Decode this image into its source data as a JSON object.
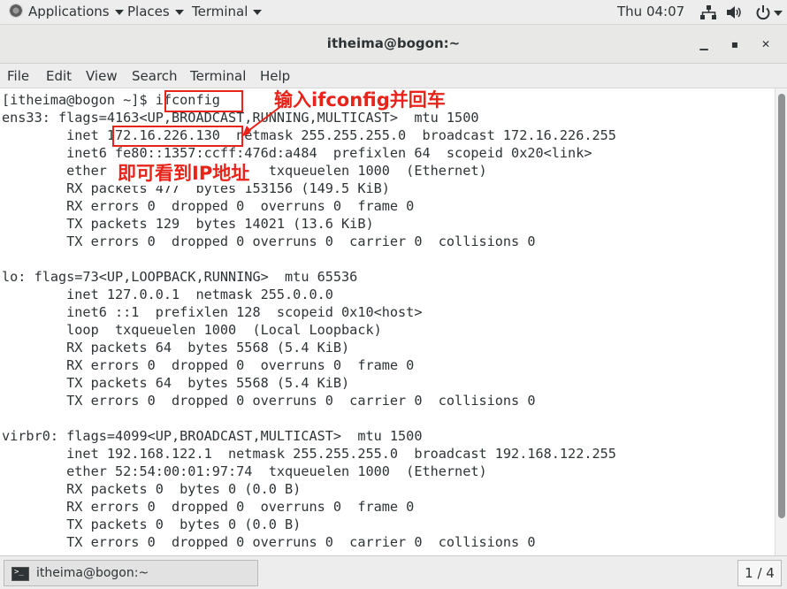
{
  "top_panel": {
    "applications_label": "Applications",
    "places_label": "Places",
    "terminal_label": "Terminal",
    "clock": "Thu 04:07"
  },
  "window": {
    "title": "itheima@bogon:~",
    "minimize_glyph": "▁",
    "maximize_glyph": "▪",
    "close_glyph": "✕"
  },
  "menubar": {
    "file": "File",
    "edit": "Edit",
    "view": "View",
    "search": "Search",
    "terminal": "Terminal",
    "help": "Help"
  },
  "terminal": {
    "lines": [
      "[itheima@bogon ~]$ ifconfig",
      "ens33: flags=4163<UP,BROADCAST,RUNNING,MULTICAST>  mtu 1500",
      "        inet 172.16.226.130  netmask 255.255.255.0  broadcast 172.16.226.255",
      "        inet6 fe80::1357:ccff:476d:a484  prefixlen 64  scopeid 0x20<link>",
      "        ether 00:0c:29:1a:2b:3c  txqueuelen 1000  (Ethernet)",
      "        RX packets 477  bytes 153156 (149.5 KiB)",
      "        RX errors 0  dropped 0  overruns 0  frame 0",
      "        TX packets 129  bytes 14021 (13.6 KiB)",
      "        TX errors 0  dropped 0 overruns 0  carrier 0  collisions 0",
      "",
      "lo: flags=73<UP,LOOPBACK,RUNNING>  mtu 65536",
      "        inet 127.0.0.1  netmask 255.0.0.0",
      "        inet6 ::1  prefixlen 128  scopeid 0x10<host>",
      "        loop  txqueuelen 1000  (Local Loopback)",
      "        RX packets 64  bytes 5568 (5.4 KiB)",
      "        RX errors 0  dropped 0  overruns 0  frame 0",
      "        TX packets 64  bytes 5568 (5.4 KiB)",
      "        TX errors 0  dropped 0 overruns 0  carrier 0  collisions 0",
      "",
      "virbr0: flags=4099<UP,BROADCAST,MULTICAST>  mtu 1500",
      "        inet 192.168.122.1  netmask 255.255.255.0  broadcast 192.168.122.255",
      "        ether 52:54:00:01:97:74  txqueuelen 1000  (Ethernet)",
      "        RX packets 0  bytes 0 (0.0 B)",
      "        RX errors 0  dropped 0  overruns 0  frame 0",
      "        TX packets 0  bytes 0 (0.0 B)",
      "        TX errors 0  dropped 0 overruns 0  carrier 0  collisions 0"
    ]
  },
  "annotations": {
    "command_note": "输入ifconfig并回车",
    "ip_note": "即可看到IP地址"
  },
  "taskbar": {
    "task_label": "itheima@bogon:~",
    "workspace": "1 / 4"
  },
  "colors": {
    "annotation": "#e8231a",
    "terminal_text": "#2e3436"
  }
}
